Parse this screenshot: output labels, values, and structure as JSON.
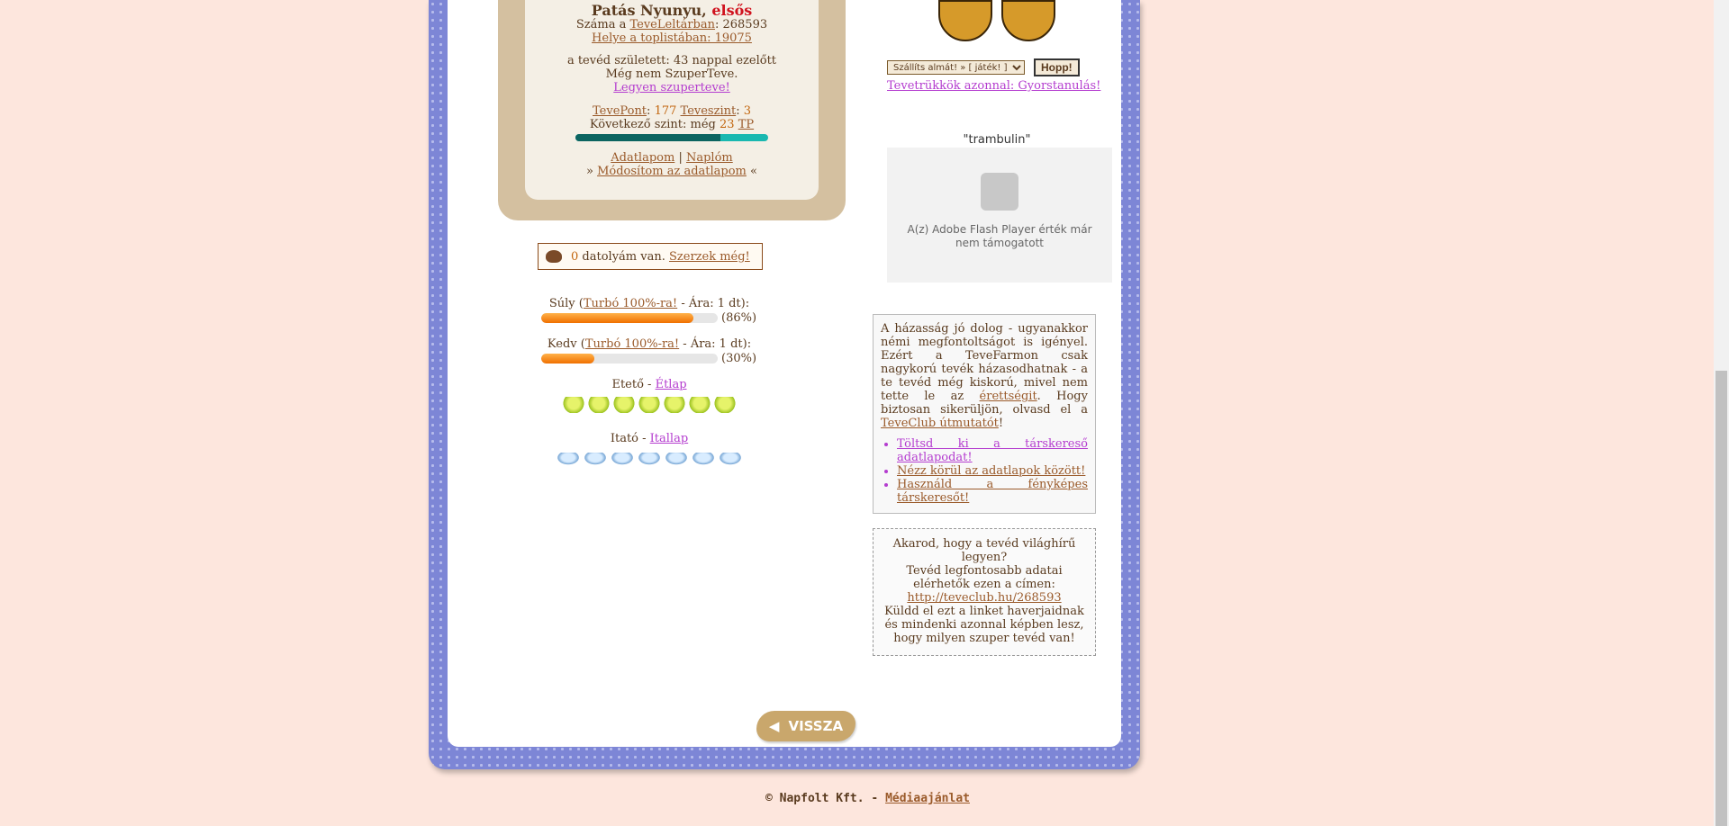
{
  "profile": {
    "name": "Patás Nyunyu,",
    "rank": "elsős",
    "inventory_prefix": "Száma a",
    "inventory_link": "TeveLeltárban",
    "inventory_number": ": 268593",
    "toplist_link": "Helye a toplistában: 19075",
    "birth": "a tevéd született: 43 nappal ezelőtt",
    "not_super": "Még nem SzuperTeve.",
    "super_link": "Legyen szuperteve!",
    "points_label": "TevePont",
    "points_value": "177",
    "level_label": "Teveszint",
    "level_value": "3",
    "next_level_text": "Következő szint: még",
    "next_level_value": "23",
    "next_level_unit": "TP",
    "level_progress": 0.75,
    "datasheet_link": "Adatlapom",
    "separator": "|",
    "diary_link": "Naplóm",
    "modify_prefix": "»",
    "modify_link": "Módosítom az adatlapom",
    "modify_suffix": "«"
  },
  "dates": {
    "count": "0",
    "text": "datolyám van.",
    "link": "Szerzek még!"
  },
  "weight": {
    "label": "Súly",
    "link": "Turbó 100%-ra!",
    "price": "- Ára: 1 dt):",
    "open_paren": "(",
    "percent_label": "(86%)",
    "value": 86
  },
  "mood": {
    "label": "Kedv",
    "link": "Turbó 100%-ra!",
    "price": "- Ára: 1 dt):",
    "open_paren": "(",
    "percent_label": "(30%)",
    "value": 30
  },
  "feeder": {
    "label": "Etető -",
    "link": "Étlap",
    "count": 7
  },
  "drinker": {
    "label": "Itató -",
    "link": "Itallap",
    "count": 7
  },
  "actions": {
    "select_value": "Szállíts almát! » [ játék! ]",
    "button": "Hopp!",
    "tricks_link": "Tevetrükkök azonnal: Gyorstanulás!"
  },
  "flash": {
    "title": "\"trambulin\"",
    "message": "A(z) Adobe Flash Player érték már nem támogatott"
  },
  "marriage": {
    "text1": "A házasság jó dolog - ugyanakkor némi megfontoltságot is igényel. Ezért a TeveFarmon csak nagykorú tevék házasodhatnak - a te tevéd még kiskorú, mivel nem tette le az",
    "maturity_link": "érettségit",
    "text2": ". Hogy biztosan sikerüljön, olvasd el a",
    "guide_link": "TeveClub útmutatót",
    "text3": "!",
    "links": [
      "Töltsd ki a társkereső adatlapodat!",
      "Nézz körül az adatlapok között!",
      "Használd a fényképes társkeresőt!"
    ]
  },
  "share": {
    "line1": "Akarod, hogy a tevéd világhírű legyen?",
    "line2": "Tevéd legfontosabb adatai elérhetők ezen a címen:",
    "url": "http://teveclub.hu/268593",
    "line3": "Küldd el ezt a linket haverjaidnak és mindenki azonnal képben lesz, hogy milyen szuper tevéd van!"
  },
  "back_button": "VISSZA",
  "footer": {
    "copyright": "©",
    "company": "Napfolt Kft. -",
    "media_link": "Médiaajánlat"
  }
}
